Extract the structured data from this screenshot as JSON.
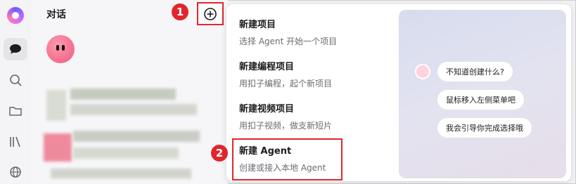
{
  "sidebar": {
    "title": "对话",
    "nav_icons": [
      "logo-icon",
      "chat-icon",
      "search-icon",
      "folder-icon",
      "library-icon",
      "globe-icon"
    ]
  },
  "annotations": {
    "badge_1": "1",
    "badge_2": "2"
  },
  "menu": {
    "items": [
      {
        "title": "新建项目",
        "desc": "选择 Agent 开始一个项目"
      },
      {
        "title": "新建编程项目",
        "desc": "用扣子编程，起个新项目"
      },
      {
        "title": "新建视频项目",
        "desc": "用扣子视频，做支新短片"
      },
      {
        "title": "新建 Agent",
        "desc": "创建或接入本地 Agent"
      }
    ]
  },
  "preview": {
    "bubbles": [
      "不知道创建什么?",
      "鼠标移入左侧菜单吧",
      "我会引导你完成选择哦"
    ]
  },
  "colors": {
    "accent_red": "#e0262c",
    "avatar_pink": "#f0577c"
  }
}
